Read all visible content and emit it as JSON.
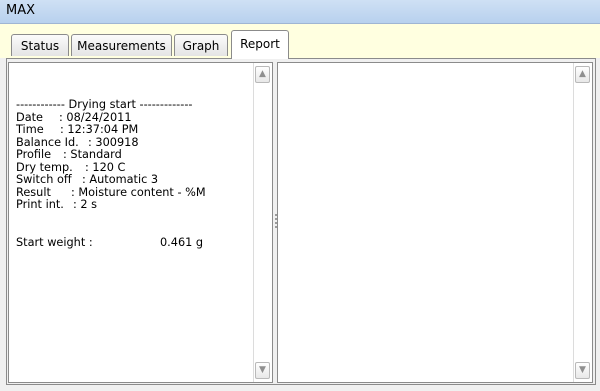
{
  "window": {
    "title": "MAX"
  },
  "tabs": [
    {
      "label": "Status"
    },
    {
      "label": "Measurements"
    },
    {
      "label": "Graph"
    },
    {
      "label": "Report"
    }
  ],
  "active_tab": "Report",
  "report": {
    "header": "------------ Drying start -------------",
    "fields": [
      {
        "key": "Date",
        "value": ": 08/24/2011"
      },
      {
        "key": "Time",
        "value": ": 12:37:04 PM"
      },
      {
        "key": "Balance Id.",
        "value": ": 300918"
      },
      {
        "key": "Profile",
        "value": ": Standard"
      },
      {
        "key": "Dry temp.",
        "value": ": 120 C"
      },
      {
        "key": "Switch off",
        "value": ": Automatic 3"
      },
      {
        "key": "Result",
        "value": ": Moisture content - %M"
      },
      {
        "key": "Print int.",
        "value": ": 2 s"
      }
    ],
    "start_weight_label": "Start weight :",
    "start_weight_value": "0.461 g"
  },
  "scroll_icons": {
    "up": "scroll-up-arrow",
    "down": "scroll-down-arrow"
  }
}
